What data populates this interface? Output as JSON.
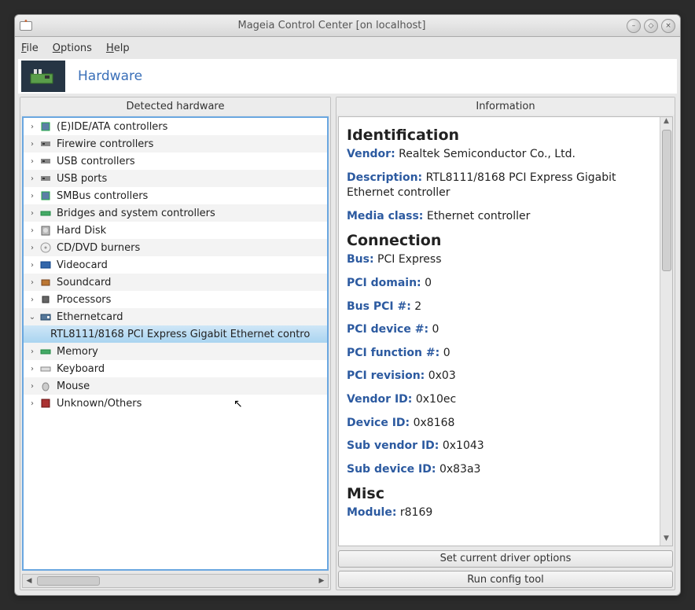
{
  "window_title": "Mageia Control Center  [on localhost]",
  "menus": {
    "file": "File",
    "options": "Options",
    "help": "Help"
  },
  "header": {
    "title": "Hardware"
  },
  "left": {
    "title": "Detected hardware",
    "items": [
      {
        "label": "(E)IDE/ATA controllers",
        "icon": "chip"
      },
      {
        "label": "Firewire controllers",
        "icon": "port"
      },
      {
        "label": "USB controllers",
        "icon": "port"
      },
      {
        "label": "USB ports",
        "icon": "port"
      },
      {
        "label": "SMBus controllers",
        "icon": "chip"
      },
      {
        "label": "Bridges and system controllers",
        "icon": "ram"
      },
      {
        "label": "Hard Disk",
        "icon": "hdd"
      },
      {
        "label": "CD/DVD burners",
        "icon": "cd"
      },
      {
        "label": "Videocard",
        "icon": "video"
      },
      {
        "label": "Soundcard",
        "icon": "sound"
      },
      {
        "label": "Processors",
        "icon": "cpu"
      },
      {
        "label": "Ethernetcard",
        "icon": "nic",
        "expanded": true
      },
      {
        "label": "RTL8111/8168 PCI Express Gigabit Ethernet contro",
        "child": true,
        "selected": true
      },
      {
        "label": "Memory",
        "icon": "ram"
      },
      {
        "label": "Keyboard",
        "icon": "kb"
      },
      {
        "label": "Mouse",
        "icon": "mouse"
      },
      {
        "label": "Unknown/Others",
        "icon": "unk"
      }
    ]
  },
  "right": {
    "title": "Information",
    "identification_heading": "Identification",
    "identification": {
      "vendor_key": "Vendor:",
      "vendor_val": "Realtek Semiconductor Co., Ltd.",
      "desc_key": "Description:",
      "desc_val": "RTL8111/8168 PCI Express Gigabit Ethernet controller",
      "media_key": "Media class:",
      "media_val": "Ethernet controller"
    },
    "connection_heading": "Connection",
    "connection": {
      "bus_key": "Bus:",
      "bus_val": "PCI Express",
      "domain_key": "PCI domain:",
      "domain_val": "0",
      "busnum_key": "Bus PCI #:",
      "busnum_val": "2",
      "device_key": "PCI device #:",
      "device_val": "0",
      "func_key": "PCI function #:",
      "func_val": "0",
      "rev_key": "PCI revision:",
      "rev_val": "0x03",
      "vendorid_key": "Vendor ID:",
      "vendorid_val": "0x10ec",
      "deviceid_key": "Device ID:",
      "deviceid_val": "0x8168",
      "subven_key": "Sub vendor ID:",
      "subven_val": "0x1043",
      "subdev_key": "Sub device ID:",
      "subdev_val": "0x83a3"
    },
    "misc_heading": "Misc",
    "misc": {
      "module_key": "Module:",
      "module_val": "r8169"
    },
    "btn1": "Set current driver options",
    "btn2": "Run config tool"
  }
}
